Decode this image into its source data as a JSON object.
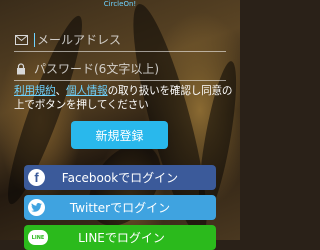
{
  "app": {
    "title": "CircleOn!"
  },
  "email": {
    "placeholder": "メールアドレス",
    "icon": "mail-icon"
  },
  "password": {
    "placeholder": "パスワード(6文字以上)",
    "icon": "lock-icon"
  },
  "notice": {
    "link_terms": "利用規約",
    "separator": "、",
    "link_privacy": "個人情報",
    "text_rest": "の取り扱いを確認し同意の上でボタンを押してください"
  },
  "register": {
    "label": "新規登録"
  },
  "sns": {
    "facebook": {
      "label": "Facebookでログイン",
      "icon_text": "f",
      "icon": "facebook-icon",
      "color": "#3b5a9a"
    },
    "twitter": {
      "label": "Twitterでログイン",
      "icon": "twitter-bird-icon",
      "color": "#3fa3e0"
    },
    "line": {
      "label": "LINEでログイン",
      "icon_text": "LINE",
      "icon": "line-icon",
      "color": "#2bba1c"
    }
  },
  "colors": {
    "accent": "#6fd3ff",
    "register": "#29b8ec"
  }
}
